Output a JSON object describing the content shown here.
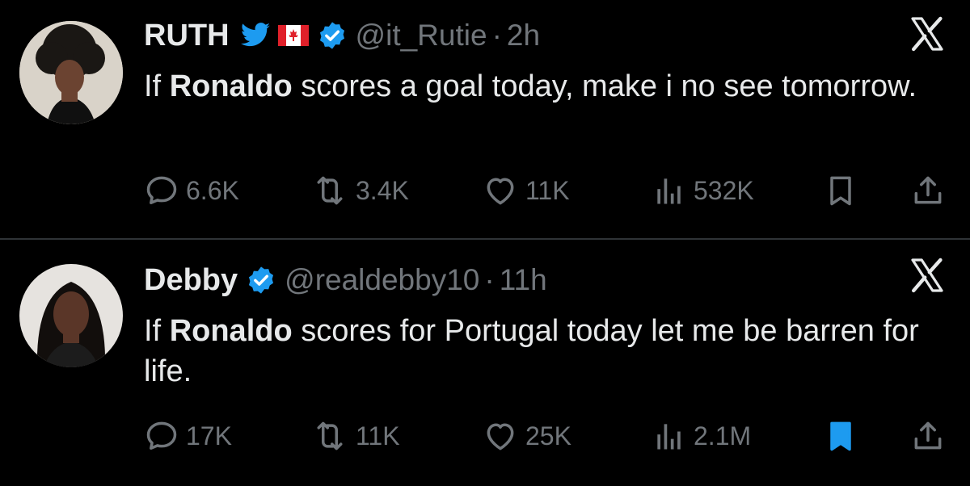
{
  "colors": {
    "background": "#000000",
    "text": "#e7e9ea",
    "muted": "#71767b",
    "verified": "#1d9bf0",
    "divider": "#2f3336"
  },
  "tweets": [
    {
      "name": "RUTH",
      "handle": "@it_Rutie",
      "separator": "·",
      "time": "2h",
      "text_before": "If ",
      "text_bold": "Ronaldo",
      "text_after": " scores a goal today, make i no see tomorrow.",
      "emojis": [
        "bird-emoji",
        "canada-flag-emoji"
      ],
      "stats": {
        "replies": "6.6K",
        "retweets": "3.4K",
        "likes": "11K",
        "views": "532K"
      },
      "bookmarked": false
    },
    {
      "name": "Debby",
      "handle": "@realdebby10",
      "separator": "·",
      "time": "11h",
      "text_before": "If ",
      "text_bold": "Ronaldo",
      "text_after": " scores for Portugal today let me be barren for life.",
      "emojis": [],
      "stats": {
        "replies": "17K",
        "retweets": "11K",
        "likes": "25K",
        "views": "2.1M"
      },
      "bookmarked": true
    }
  ]
}
